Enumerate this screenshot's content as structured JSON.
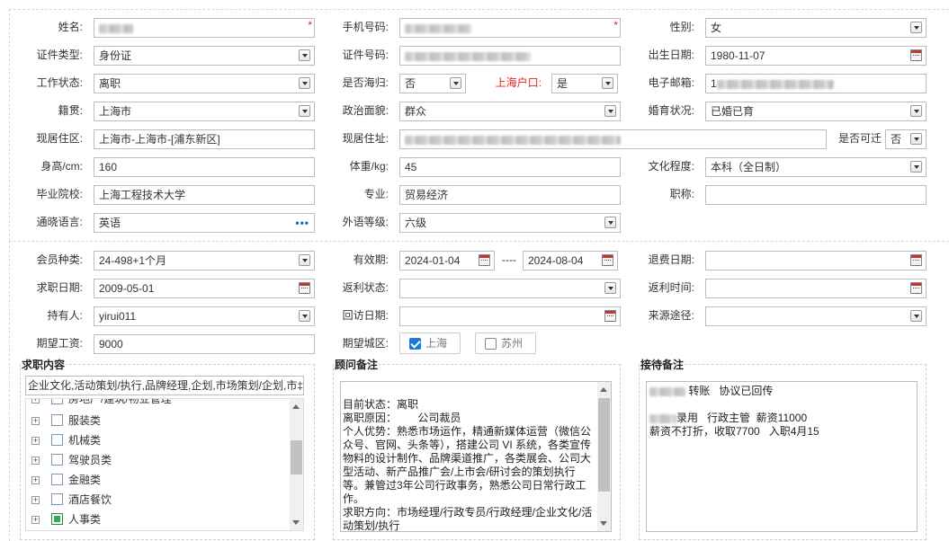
{
  "basic": {
    "name": {
      "label": "姓名:"
    },
    "phone": {
      "label": "手机号码:"
    },
    "gender": {
      "label": "性别:",
      "value": "女"
    },
    "id_type": {
      "label": "证件类型:",
      "value": "身份证"
    },
    "id_no": {
      "label": "证件号码:"
    },
    "birth": {
      "label": "出生日期:",
      "value": "1980-11-07"
    },
    "work_status": {
      "label": "工作状态:",
      "value": "离职"
    },
    "returnee": {
      "label": "是否海归:",
      "value": "否"
    },
    "sh_hukou": {
      "label": "上海户口:",
      "value": "是"
    },
    "email": {
      "label": "电子邮箱:",
      "value": "1"
    },
    "native": {
      "label": "籍贯:",
      "value": "上海市"
    },
    "politics": {
      "label": "政治面貌:",
      "value": "群众"
    },
    "marital": {
      "label": "婚育状况:",
      "value": "已婚已育"
    },
    "residence": {
      "label": "现居住区:",
      "value": "上海市-上海市-[浦东新区]"
    },
    "address": {
      "label": "现居住址:"
    },
    "relocate": {
      "label": "是否可迁",
      "value": "否"
    },
    "height": {
      "label": "身高/cm:",
      "value": "160"
    },
    "weight": {
      "label": "体重/kg:",
      "value": "45"
    },
    "education": {
      "label": "文化程度:",
      "value": "本科（全日制）"
    },
    "school": {
      "label": "毕业院校:",
      "value": "上海工程技术大学"
    },
    "major": {
      "label": "专业:",
      "value": "贸易经济"
    },
    "title": {
      "label": "职称:",
      "value": ""
    },
    "language": {
      "label": "通晓语言:",
      "value": "英语",
      "more": "•••"
    },
    "lang_level": {
      "label": "外语等级:",
      "value": "六级"
    }
  },
  "member": {
    "type": {
      "label": "会员种类:",
      "value": "24-498+1个月"
    },
    "valid": {
      "label": "有效期:",
      "from": "2024-01-04",
      "sep": "----",
      "to": "2024-08-04"
    },
    "refund_date": {
      "label": "退费日期:",
      "value": ""
    },
    "job_date": {
      "label": "求职日期:",
      "value": "2009-05-01"
    },
    "rebate_status": {
      "label": "返利状态:",
      "value": ""
    },
    "rebate_time": {
      "label": "返利时间:",
      "value": ""
    },
    "holder": {
      "label": "持有人:",
      "value": "yirui011"
    },
    "revisit": {
      "label": "回访日期:",
      "value": ""
    },
    "source": {
      "label": "来源途径:",
      "value": ""
    },
    "salary": {
      "label": "期望工资:",
      "value": "9000"
    },
    "city": {
      "label": "期望城区:",
      "options": [
        {
          "label": "上海",
          "checked": true
        },
        {
          "label": "苏州",
          "checked": false
        }
      ]
    }
  },
  "job_content": {
    "legend": "求职内容",
    "summary": "企业文化,活动策划/执行,品牌经理,企划,市场策划/企划,市‡",
    "partial_item": "房地产/建筑/物业管理",
    "items": [
      {
        "label": "服装类",
        "checked": false
      },
      {
        "label": "机械类",
        "checked": false
      },
      {
        "label": "驾驶员类",
        "checked": false
      },
      {
        "label": "金融类",
        "checked": false
      },
      {
        "label": "酒店餐饮",
        "checked": false
      },
      {
        "label": "人事类",
        "checked": true
      }
    ]
  },
  "advisor": {
    "legend": "顾问备注",
    "text": "目前状态：离职\n离职原因：       公司裁员\n个人优势：熟悉市场运作，精通新媒体运营（微信公众号、官网、头条等），搭建公司 VI 系统，各类宣传物料的设计制作、品牌渠道推广，各类展会、公司大型活动、新产品推广会/上市会/研讨会的策划执行等。兼管过3年公司行政事务，熟悉公司日常行政工作。\n求职方向：市场经理/行政专员/行政经理/企业文化/活动策划/执行"
  },
  "reception": {
    "legend": "接待备注",
    "line1": "转账   协议已回传",
    "line2": "录用   行政主管  薪资11000",
    "line3": "薪资不打折，收取7700   入职4月15"
  }
}
